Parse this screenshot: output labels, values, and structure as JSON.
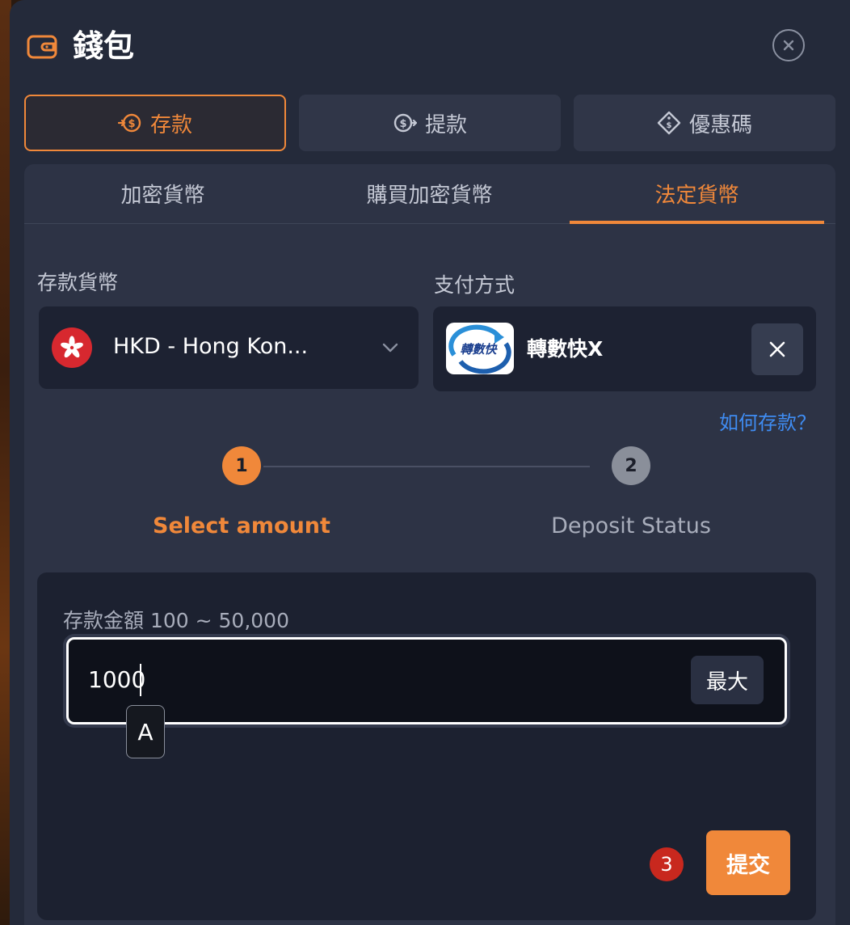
{
  "header": {
    "title": "錢包",
    "icon": "wallet-icon",
    "close_icon": "close-icon"
  },
  "main_tabs": [
    {
      "label": "存款",
      "icon": "deposit-coin-icon",
      "active": true
    },
    {
      "label": "提款",
      "icon": "withdraw-coin-icon",
      "active": false
    },
    {
      "label": "優惠碼",
      "icon": "coupon-tag-icon",
      "active": false
    }
  ],
  "sub_tabs": [
    {
      "label": "加密貨幣",
      "active": false
    },
    {
      "label": "購買加密貨幣",
      "active": false
    },
    {
      "label": "法定貨幣",
      "active": true
    }
  ],
  "currency": {
    "label": "存款貨幣",
    "value": "HKD - Hong Kon...",
    "flag_icon": "hong-kong-flag-icon"
  },
  "payment": {
    "label": "支付方式",
    "logo_text": "轉數快",
    "name": "轉數快X"
  },
  "help_link": "如何存款？",
  "steps": [
    {
      "number": "1",
      "label": "Select amount",
      "active": true
    },
    {
      "number": "2",
      "label": "Deposit Status",
      "active": false
    }
  ],
  "amount": {
    "label": "存款金額 100 ~ 50,000",
    "value": "1000",
    "max_label": "最大"
  },
  "tooltip_key": "A",
  "annotation_badge": "3",
  "submit_label": "提交",
  "colors": {
    "accent": "#f0883a",
    "link": "#3f8cf2",
    "modal_bg": "#242a3a",
    "panel_bg": "#2d3345",
    "inactive_step": "#8a8f9a"
  }
}
